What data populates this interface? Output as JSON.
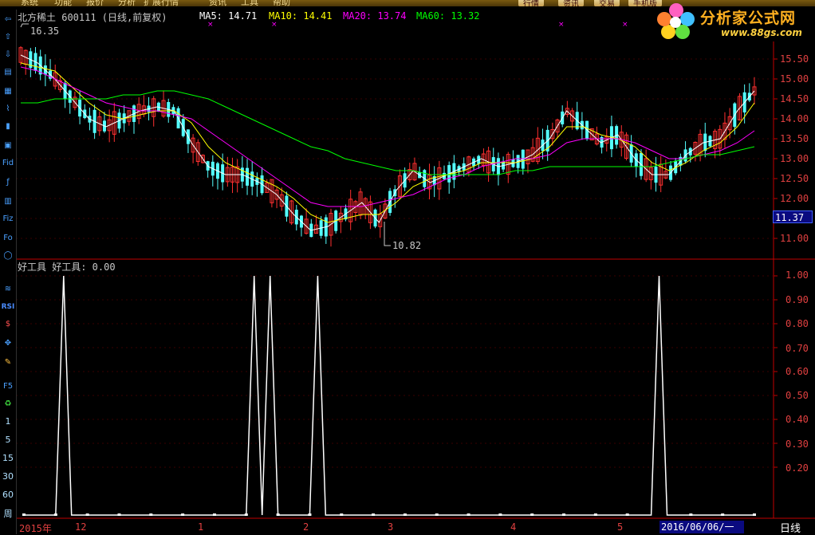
{
  "menu": {
    "items": [
      "系统",
      "功能",
      "报价",
      "分析",
      "扩展行情",
      "资讯",
      "工具",
      "帮助"
    ],
    "right_buttons": [
      "行情",
      "资讯",
      "交易",
      "手机版"
    ]
  },
  "logo": {
    "brand": "分析家公式网",
    "url": "www.88gs.com"
  },
  "stock_header": {
    "name_code": "北方稀土  600111 (日线,前复权)",
    "ma5_label": "MA5: 14.71",
    "ma10_label": "MA10: 14.41",
    "ma20_label": "MA20: 13.74",
    "ma60_label": "MA60: 13.32",
    "high_marker": "16.35",
    "low_marker": "10.82",
    "current_price": "11.37"
  },
  "indicator_header": "好工具 好工具: 0.00",
  "price_axis": [
    "15.50",
    "15.00",
    "14.50",
    "14.00",
    "13.50",
    "13.00",
    "12.50",
    "12.00",
    "11.00"
  ],
  "indicator_axis": [
    "1.00",
    "0.90",
    "0.80",
    "0.70",
    "0.60",
    "0.50",
    "0.40",
    "0.30",
    "0.20"
  ],
  "time_axis": [
    "2015年",
    "12",
    "1",
    "2",
    "3",
    "4",
    "5"
  ],
  "cursor_date": "2016/06/06/一",
  "period_label": "日线",
  "toolbar": {
    "numbers": [
      "1",
      "5",
      "15",
      "30",
      "60",
      "周"
    ],
    "text_icons": [
      "Fid",
      "Fiz",
      "Fo",
      "RSI",
      "F5"
    ]
  },
  "colors": {
    "ma5": "#ffffff",
    "ma10": "#ffff00",
    "ma20": "#ff00ff",
    "ma60": "#00ff00",
    "up_candle": "#ff3030",
    "down_candle": "#54ffff",
    "axis": "#c00000"
  },
  "chart_data": [
    {
      "type": "candlestick",
      "title": "北方稀土 600111 (日线,前复权)",
      "ylim": [
        10.8,
        16.35
      ],
      "ma": {
        "MA5": 14.71,
        "MA10": 14.41,
        "MA20": 13.74,
        "MA60": 13.32
      },
      "series": [
        {
          "name": "MA5",
          "values": [
            15.6,
            15.4,
            15.0,
            14.5,
            14.0,
            13.8,
            14.0,
            14.2,
            14.3,
            14.2,
            13.4,
            12.8,
            12.6,
            12.6,
            12.4,
            12.1,
            11.6,
            11.2,
            11.3,
            11.6,
            11.9,
            11.4,
            12.2,
            12.7,
            12.4,
            12.6,
            12.8,
            13.0,
            12.8,
            12.9,
            13.1,
            13.5,
            14.2,
            13.8,
            13.4,
            13.6,
            13.0,
            12.6,
            12.6,
            13.1,
            13.4,
            13.5,
            14.2,
            14.7
          ]
        },
        {
          "name": "MA10",
          "values": [
            15.4,
            15.3,
            15.2,
            14.8,
            14.4,
            14.1,
            14.0,
            14.1,
            14.2,
            14.2,
            13.9,
            13.3,
            12.9,
            12.7,
            12.5,
            12.3,
            12.0,
            11.6,
            11.4,
            11.5,
            11.6,
            11.6,
            11.9,
            12.3,
            12.5,
            12.6,
            12.7,
            12.9,
            12.9,
            12.9,
            13.0,
            13.3,
            13.8,
            13.8,
            13.6,
            13.5,
            13.3,
            12.9,
            12.7,
            12.9,
            13.2,
            13.4,
            13.8,
            14.4
          ]
        },
        {
          "name": "MA20",
          "values": [
            15.3,
            15.2,
            15.0,
            14.8,
            14.6,
            14.4,
            14.3,
            14.2,
            14.2,
            14.1,
            14.0,
            13.7,
            13.4,
            13.1,
            12.8,
            12.5,
            12.2,
            11.9,
            11.8,
            11.8,
            11.8,
            11.9,
            12.0,
            12.1,
            12.3,
            12.5,
            12.6,
            12.8,
            12.9,
            13.0,
            13.0,
            13.1,
            13.4,
            13.5,
            13.5,
            13.5,
            13.4,
            13.2,
            13.0,
            13.0,
            13.1,
            13.2,
            13.4,
            13.7
          ]
        },
        {
          "name": "MA60",
          "values": [
            14.4,
            14.4,
            14.5,
            14.5,
            14.5,
            14.5,
            14.6,
            14.6,
            14.7,
            14.7,
            14.6,
            14.5,
            14.3,
            14.1,
            13.9,
            13.7,
            13.5,
            13.3,
            13.2,
            13.0,
            12.9,
            12.8,
            12.7,
            12.7,
            12.6,
            12.6,
            12.6,
            12.6,
            12.6,
            12.7,
            12.7,
            12.8,
            12.8,
            12.8,
            12.8,
            12.8,
            12.8,
            12.8,
            12.9,
            13.0,
            13.1,
            13.1,
            13.2,
            13.3
          ]
        }
      ]
    },
    {
      "type": "line",
      "title": "好工具",
      "ylim": [
        0,
        1.0
      ],
      "series": [
        {
          "name": "好工具",
          "values": [
            0,
            0,
            0,
            0,
            0,
            1,
            0,
            0,
            0,
            0,
            0,
            0,
            0,
            0,
            0,
            0,
            0,
            0,
            0,
            0,
            0,
            0,
            0,
            0,
            0,
            0,
            0,
            0,
            0,
            1,
            0,
            1,
            0,
            0,
            0,
            0,
            0,
            1,
            0,
            0,
            0,
            0,
            0,
            0,
            0,
            0,
            0,
            0,
            0,
            0,
            0,
            0,
            0,
            0,
            0,
            0,
            0,
            0,
            0,
            0,
            0,
            0,
            0,
            0,
            0,
            0,
            0,
            0,
            0,
            0,
            0,
            0,
            0,
            0,
            0,
            0,
            0,
            0,
            0,
            0,
            1,
            0,
            0,
            0,
            0,
            0,
            0,
            0,
            0,
            0,
            0,
            0,
            0
          ]
        }
      ]
    }
  ]
}
